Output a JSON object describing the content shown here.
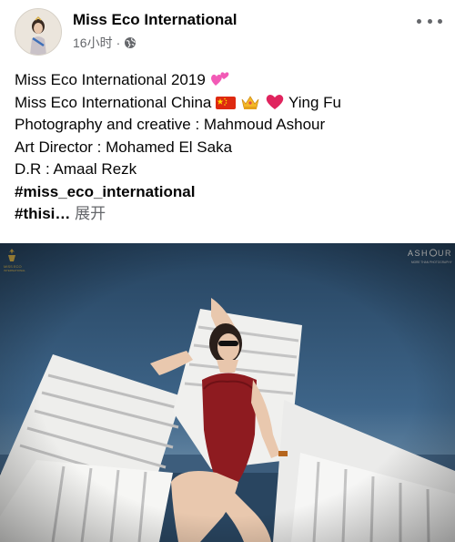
{
  "post": {
    "page_name": "Miss Eco International",
    "timestamp": "16小时",
    "separator": "·",
    "privacy_icon": "globe-icon",
    "more_icon": "more-dots-icon",
    "lines": {
      "title": "Miss Eco International 2019",
      "china_prefix": "Miss Eco International China",
      "china_name": "Ying Fu",
      "photography": "Photography and creative : Mahmoud Ashour",
      "art_director": "Art Director : Mohamed El Saka",
      "dr": "D.R : Amaal Rezk",
      "hashtag1": "#miss_eco_international",
      "hashtag2_partial": "#thisi…",
      "see_more": "展开"
    },
    "photo": {
      "logo_text": "MISS ECO INTERNATIONAL",
      "watermark": "ASH  UR",
      "watermark_sub": "MORE THAN PHOTOGRAPHY"
    },
    "colors": {
      "sky": "#2f4f73",
      "swimsuit": "#8e1b20",
      "chair": "#f2f2f0"
    }
  }
}
